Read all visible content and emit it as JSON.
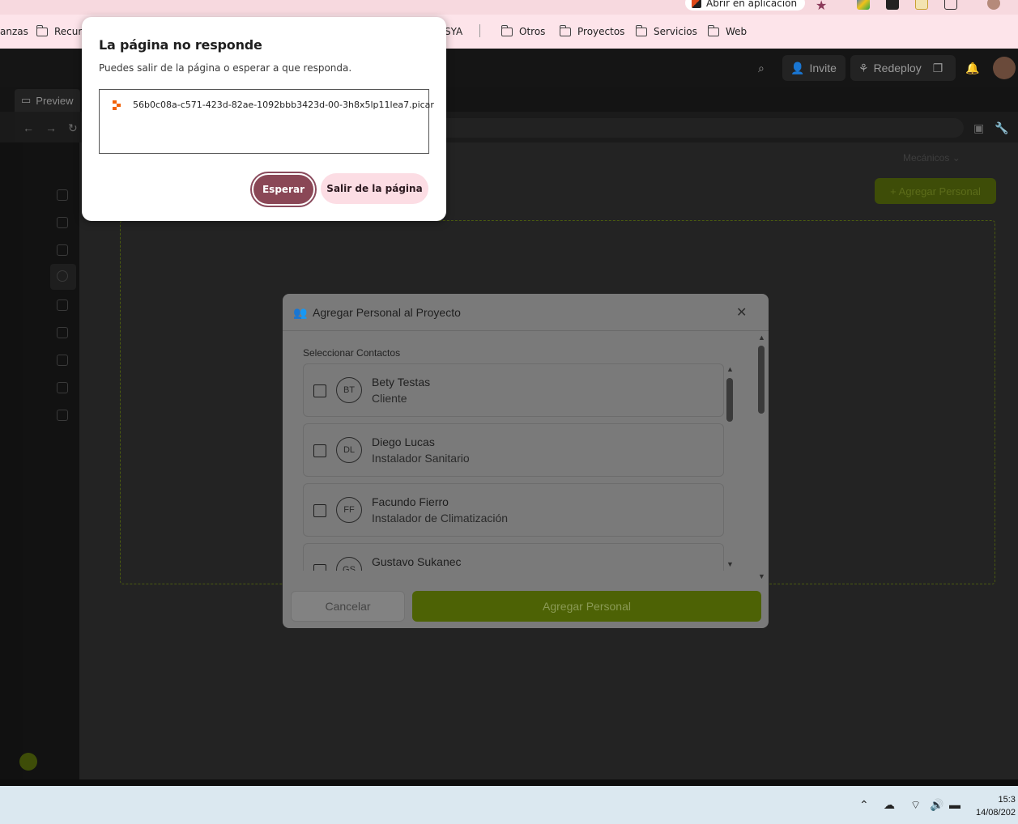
{
  "browser": {
    "open_app_label": "Abrir en aplicación",
    "bookmarks": [
      {
        "label": "anzas",
        "folder": false
      },
      {
        "label": "Recurs",
        "folder": true
      },
      {
        "label": "SYA",
        "folder": false
      },
      {
        "label": "Otros",
        "folder": true
      },
      {
        "label": "Proyectos",
        "folder": true
      },
      {
        "label": "Servicios",
        "folder": true
      },
      {
        "label": "Web",
        "folder": true
      }
    ]
  },
  "app": {
    "header": {
      "invite": "Invite",
      "redeploy": "Redeploy"
    },
    "preview_tab": "Preview",
    "bg_filter": "Mecánicos",
    "bg_add_button": "+ Agregar Personal"
  },
  "modal": {
    "title": "Agregar Personal al Proyecto",
    "select_label": "Seleccionar Contactos",
    "contacts": [
      {
        "initials": "BT",
        "name": "Bety Testas",
        "role": "Cliente"
      },
      {
        "initials": "DL",
        "name": "Diego Lucas",
        "role": "Instalador Sanitario"
      },
      {
        "initials": "FF",
        "name": "Facundo Fierro",
        "role": "Instalador de Climatización"
      },
      {
        "initials": "GS",
        "name": "Gustavo Sukanec",
        "role": ""
      }
    ],
    "cancel": "Cancelar",
    "add": "Agregar Personal"
  },
  "dialog": {
    "title": "La página no responde",
    "subtitle": "Puedes salir de la página o esperar a que responda.",
    "file": "56b0c08a-c571-423d-82ae-1092bbb3423d-00-3h8x5lp11lea7.picar",
    "wait": "Esperar",
    "exit": "Salir de la página"
  },
  "taskbar": {
    "time": "15:3",
    "date": "14/08/202"
  },
  "colors": {
    "dialog_primary": "#8a4756",
    "dialog_secondary": "#fcdde4",
    "accent_green": "#4d6205"
  }
}
